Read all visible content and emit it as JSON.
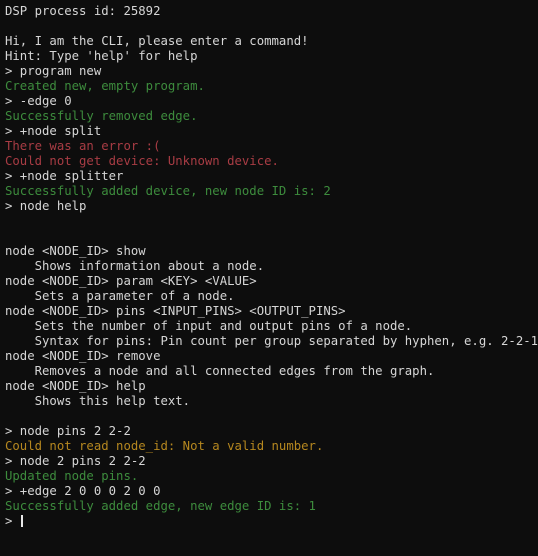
{
  "terminal": {
    "background_color": "#0d0d0d",
    "colors": {
      "default": "#d6d6d6",
      "success": "#3d8c3d",
      "error": "#a83c44",
      "warning": "#b5871f",
      "cursor": "#e8e8e8"
    },
    "prompt_symbol": ">",
    "lines": [
      {
        "text": "DSP process id: 25892",
        "style": "default"
      },
      {
        "text": "",
        "style": "default"
      },
      {
        "text": "Hi, I am the CLI, please enter a command!",
        "style": "default"
      },
      {
        "text": "Hint: Type 'help' for help",
        "style": "default"
      },
      {
        "text": "> program new",
        "style": "default"
      },
      {
        "text": "Created new, empty program.",
        "style": "success"
      },
      {
        "text": "> -edge 0",
        "style": "default"
      },
      {
        "text": "Successfully removed edge.",
        "style": "success"
      },
      {
        "text": "> +node split",
        "style": "default"
      },
      {
        "text": "There was an error :(",
        "style": "error"
      },
      {
        "text": "Could not get device: Unknown device.",
        "style": "error"
      },
      {
        "text": "> +node splitter",
        "style": "default"
      },
      {
        "text": "Successfully added device, new node ID is: 2",
        "style": "success"
      },
      {
        "text": "> node help",
        "style": "default"
      },
      {
        "text": "",
        "style": "default"
      },
      {
        "text": "",
        "style": "default"
      },
      {
        "text": "node <NODE_ID> show",
        "style": "default"
      },
      {
        "text": "    Shows information about a node.",
        "style": "default"
      },
      {
        "text": "node <NODE_ID> param <KEY> <VALUE>",
        "style": "default"
      },
      {
        "text": "    Sets a parameter of a node.",
        "style": "default"
      },
      {
        "text": "node <NODE_ID> pins <INPUT_PINS> <OUTPUT_PINS>",
        "style": "default"
      },
      {
        "text": "    Sets the number of input and output pins of a node.",
        "style": "default"
      },
      {
        "text": "    Syntax for pins: Pin count per group separated by hyphen, e.g. 2-2-1",
        "style": "default"
      },
      {
        "text": "node <NODE_ID> remove",
        "style": "default"
      },
      {
        "text": "    Removes a node and all connected edges from the graph.",
        "style": "default"
      },
      {
        "text": "node <NODE_ID> help",
        "style": "default"
      },
      {
        "text": "    Shows this help text.",
        "style": "default"
      },
      {
        "text": "",
        "style": "default"
      },
      {
        "text": "> node pins 2 2-2",
        "style": "default"
      },
      {
        "text": "Could not read node_id: Not a valid number.",
        "style": "warning"
      },
      {
        "text": "> node 2 pins 2 2-2",
        "style": "default"
      },
      {
        "text": "Updated node pins.",
        "style": "success"
      },
      {
        "text": "> +edge 2 0 0 0 2 0 0",
        "style": "default"
      },
      {
        "text": "Successfully added edge, new edge ID is: 1",
        "style": "success"
      },
      {
        "text": "> ",
        "style": "default",
        "cursor": true
      }
    ]
  }
}
